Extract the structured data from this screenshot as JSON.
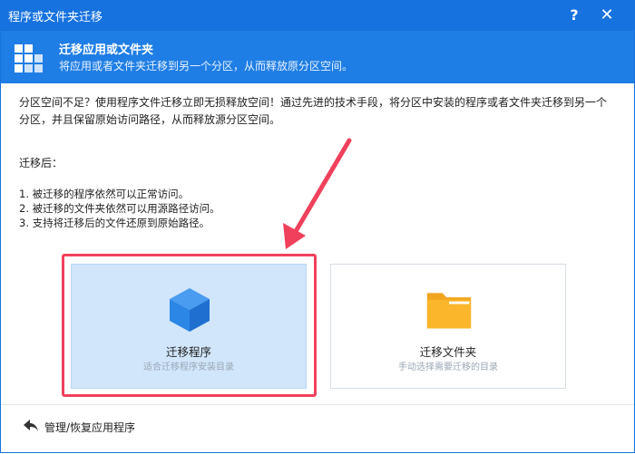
{
  "window": {
    "title": "程序或文件夹迁移",
    "help_label": "?",
    "close_label": "✕"
  },
  "header": {
    "title": "迁移应用或文件夹",
    "subtitle": "将应用或者文件夹迁移到另一个分区，从而释放原分区空间。"
  },
  "content": {
    "description_line1": "分区空间不足？使用程序文件迁移立即无损释放空间！通过先进的技术手段，将分区中安装的程序或者文件夹迁移到另一个",
    "description_line2": "分区，并且保留原始访问路径，从而释放源分区空间。",
    "after_title": "迁移后：",
    "points": [
      "1. 被迁移的程序依然可以正常访问。",
      "2. 被迁移的文件夹依然可以用源路径访问。",
      "3. 支持将迁移后的文件还原到原始路径。"
    ]
  },
  "cards": [
    {
      "title": "迁移程序",
      "subtitle": "适合迁移程序安装目录",
      "icon": "cube-icon",
      "selected": true
    },
    {
      "title": "迁移文件夹",
      "subtitle": "手动选择需要迁移的目录",
      "icon": "folder-icon",
      "selected": false
    }
  ],
  "footer": {
    "link_label": "管理/恢复应用程序",
    "icon": "back-arrow-icon"
  },
  "colors": {
    "titlebar": "#1672de",
    "header": "#1f7ee5",
    "selected_card": "#d1e6fb",
    "highlight": "#f0415c",
    "cube": "#2c86e6",
    "folder": "#fbb62b"
  }
}
